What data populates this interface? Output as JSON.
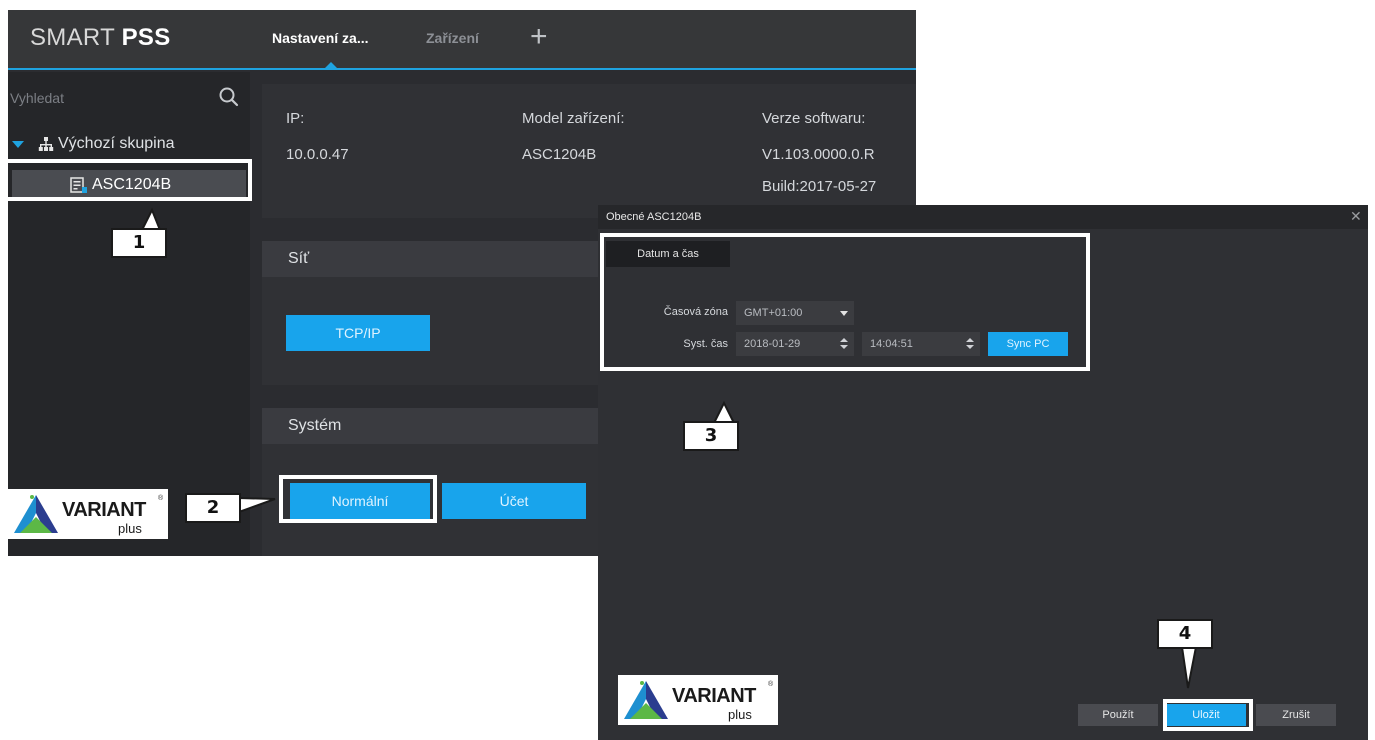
{
  "main_window": {
    "app_title_light": "SMART ",
    "app_title_bold": "PSS",
    "tabs": [
      {
        "label": "Nastavení za..."
      },
      {
        "label": "Zařízení"
      }
    ],
    "add_tab_icon": "plus-icon",
    "sidebar": {
      "search_placeholder": "Vyhledat",
      "search_icon": "search-icon",
      "group_label": "Výchozí skupina",
      "device_label": "ASC1204B"
    },
    "info": {
      "ip_label": "IP:",
      "ip_value": "10.0.0.47",
      "model_label": "Model zařízení:",
      "model_value": "ASC1204B",
      "software_label": "Verze softwaru:",
      "software_value": "V1.103.0000.0.R",
      "build_value": "Build:2017-05-27"
    },
    "network_panel": {
      "title": "Síť",
      "tcpip_button": "TCP/IP"
    },
    "system_panel": {
      "title": "Systém",
      "normal_button": "Normální",
      "account_button": "Účet"
    }
  },
  "dialog": {
    "title": "Obecné ASC1204B",
    "close_icon": "close-icon",
    "tab_label": "Datum a čas",
    "timezone_label": "Časová zóna",
    "timezone_value": "GMT+01:00",
    "systime_label": "Syst. čas",
    "date_value": "2018-01-29",
    "time_value": "14:04:51",
    "sync_button": "Sync PC",
    "apply_button": "Použít",
    "save_button": "Uložit",
    "cancel_button": "Zrušit"
  },
  "logo": {
    "word": "VARIANT",
    "sub": "plus",
    "reg": "®"
  },
  "callouts": [
    "1",
    "2",
    "3",
    "4"
  ],
  "colors": {
    "accent": "#18a4ec",
    "window_bg": "#2b2c30",
    "titlebar_bg": "#363739"
  }
}
